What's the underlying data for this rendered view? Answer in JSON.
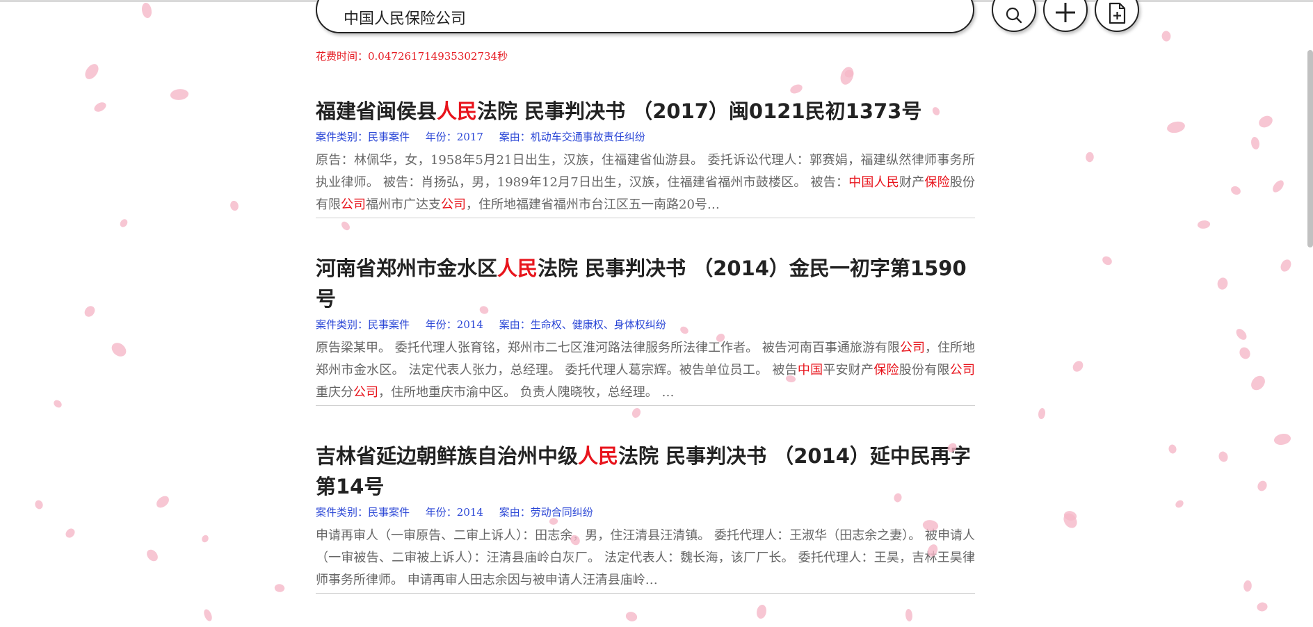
{
  "search": {
    "query": "中国人民保险公司",
    "time_label": "花费时间：0.047261714935302734秒"
  },
  "buttons": {
    "search_icon": "search-icon",
    "add_icon": "plus-icon",
    "upload_icon": "add-file-icon"
  },
  "results": [
    {
      "title_pre": "福建省闽侯县",
      "title_hl": "人民",
      "title_post": "法院 民事判决书 （2017）闽0121民初1373号",
      "category": "案件类别：民事案件",
      "year": "年份：2017",
      "cause": "案由：机动车交通事故责任纠纷",
      "snippet": [
        {
          "t": "原告：林佩华，女，1958年5月21日出生，汉族，住福建省仙游县。 委托诉讼代理人：郭赛娟，福建纵然律师事务所执业律师。 被告：肖扬弘，男，1989年12月7日出生，汉族，住福建省福州市鼓楼区。 被告：",
          "h": false
        },
        {
          "t": "中国人民",
          "h": true
        },
        {
          "t": "财产",
          "h": false
        },
        {
          "t": "保险",
          "h": true
        },
        {
          "t": "股份有限",
          "h": false
        },
        {
          "t": "公司",
          "h": true
        },
        {
          "t": "福州市广达支",
          "h": false
        },
        {
          "t": "公司",
          "h": true
        },
        {
          "t": "，住所地福建省福州市台江区五一南路20号…",
          "h": false
        }
      ]
    },
    {
      "title_pre": "河南省郑州市金水区",
      "title_hl": "人民",
      "title_post": "法院 民事判决书 （2014）金民一初字第1590号",
      "category": "案件类别：民事案件",
      "year": "年份：2014",
      "cause": "案由：生命权、健康权、身体权纠纷",
      "snippet": [
        {
          "t": "原告梁某甲。 委托代理人张育铭，郑州市二七区淮河路法律服务所法律工作者。 被告河南百事通旅游有限",
          "h": false
        },
        {
          "t": "公司",
          "h": true
        },
        {
          "t": "，住所地郑州市金水区。 法定代表人张力，总经理。 委托代理人葛宗辉。被告单位员工。 被告",
          "h": false
        },
        {
          "t": "中国",
          "h": true
        },
        {
          "t": "平安财产",
          "h": false
        },
        {
          "t": "保险",
          "h": true
        },
        {
          "t": "股份有限",
          "h": false
        },
        {
          "t": "公司",
          "h": true
        },
        {
          "t": "重庆分",
          "h": false
        },
        {
          "t": "公司",
          "h": true
        },
        {
          "t": "，住所地重庆市渝中区。 负责人隗晓牧，总经理。 …",
          "h": false
        }
      ]
    },
    {
      "title_pre": "吉林省延边朝鲜族自治州中级",
      "title_hl": "人民",
      "title_post": "法院 民事判决书 （2014）延中民再字第14号",
      "category": "案件类别：民事案件",
      "year": "年份：2014",
      "cause": "案由：劳动合同纠纷",
      "snippet": [
        {
          "t": "申请再审人（一审原告、二审上诉人）：田志余，男，住汪清县汪清镇。 委托代理人：王淑华（田志余之妻）。 被申请人（一审被告、二审被上诉人）：汪清县庙岭白灰厂。 法定代表人：魏长海，该厂厂长。 委托代理人：王昊，吉林王昊律师事务所律师。 申请再审人田志余因与被申请人汪清县庙岭…",
          "h": false
        }
      ]
    }
  ]
}
